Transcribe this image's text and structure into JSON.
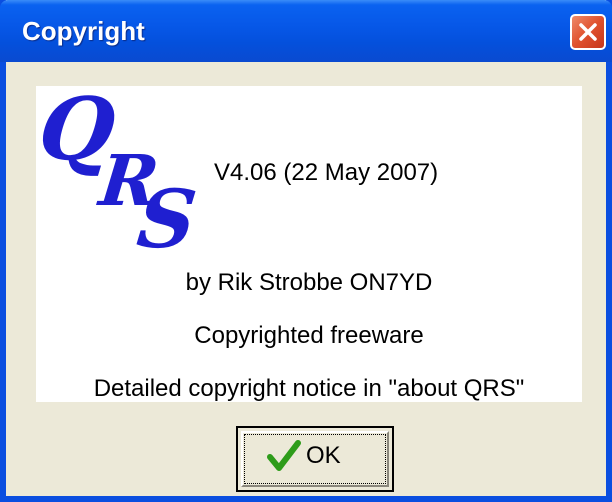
{
  "window": {
    "title": "Copyright"
  },
  "logo": {
    "text": "QRS",
    "color": "#1f1fd0"
  },
  "content": {
    "version": "V4.06  (22 May 2007)",
    "author": "by Rik Strobbe   ON7YD",
    "license": "Copyrighted freeware",
    "notice": "Detailed  copyright notice in \"about QRS\""
  },
  "buttons": {
    "ok_label": "OK",
    "ok_icon": "check-icon",
    "close_icon": "close-icon"
  },
  "colors": {
    "titlebar": "#0758e8",
    "close": "#e0512d",
    "dialog_bg": "#ece9d8",
    "check": "#2e9c1a"
  }
}
